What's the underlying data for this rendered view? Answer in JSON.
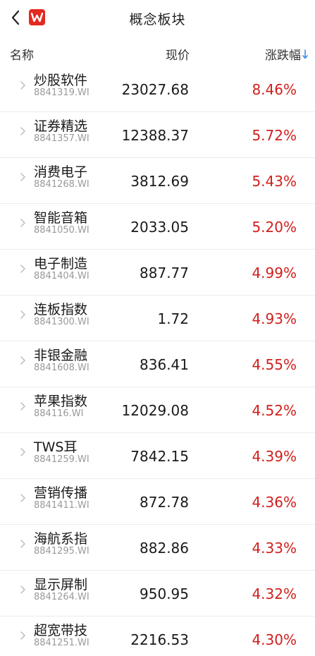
{
  "nav": {
    "title": "概念板块",
    "logo_text": "W",
    "logo_color": "#e32a21",
    "back_icon": "chevron-left-icon"
  },
  "header": {
    "name_label": "名称",
    "price_label": "现价",
    "change_label": "涨跌幅",
    "sort_icon": "arrow-down-icon"
  },
  "colors": {
    "up": "#d0201d",
    "accent_sort": "#3a8ee6"
  },
  "rows": [
    {
      "name": "炒股软件",
      "code": "8841319.WI",
      "price": "23027.68",
      "change": "8.46%"
    },
    {
      "name": "证券精选",
      "code": "8841357.WI",
      "price": "12388.37",
      "change": "5.72%"
    },
    {
      "name": "消费电子",
      "code": "8841268.WI",
      "price": "3812.69",
      "change": "5.43%"
    },
    {
      "name": "智能音箱",
      "code": "8841050.WI",
      "price": "2033.05",
      "change": "5.20%"
    },
    {
      "name": "电子制造",
      "code": "8841404.WI",
      "price": "887.77",
      "change": "4.99%"
    },
    {
      "name": "连板指数",
      "code": "8841300.WI",
      "price": "1.72",
      "change": "4.93%"
    },
    {
      "name": "非银金融",
      "code": "8841608.WI",
      "price": "836.41",
      "change": "4.55%"
    },
    {
      "name": "苹果指数",
      "code": "884116.WI",
      "price": "12029.08",
      "change": "4.52%"
    },
    {
      "name": "TWS耳",
      "code": "8841259.WI",
      "price": "7842.15",
      "change": "4.39%"
    },
    {
      "name": "营销传播",
      "code": "8841411.WI",
      "price": "872.78",
      "change": "4.36%"
    },
    {
      "name": "海航系指",
      "code": "8841295.WI",
      "price": "882.86",
      "change": "4.33%"
    },
    {
      "name": "显示屏制",
      "code": "8841264.WI",
      "price": "950.95",
      "change": "4.32%"
    },
    {
      "name": "超宽带技",
      "code": "8841251.WI",
      "price": "2216.53",
      "change": "4.30%"
    }
  ]
}
